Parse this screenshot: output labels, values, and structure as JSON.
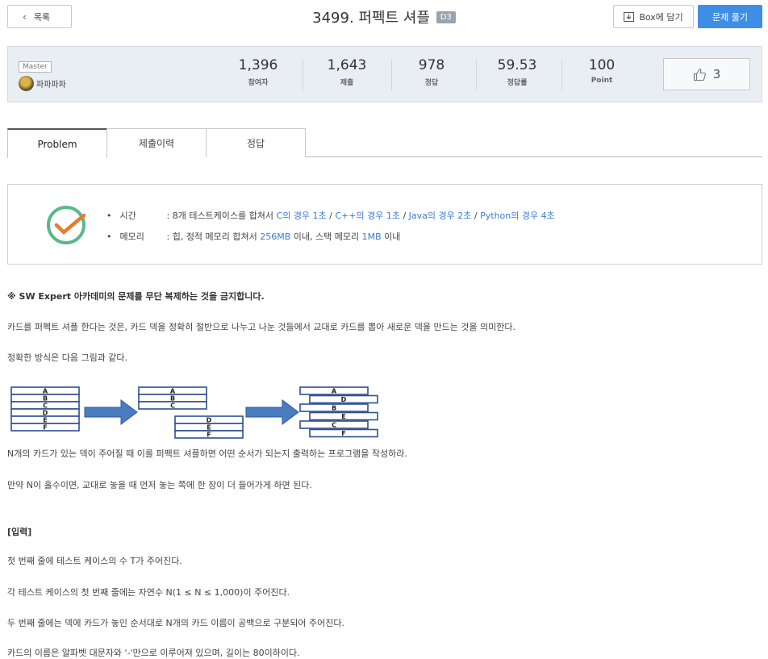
{
  "header": {
    "back_label": "목록",
    "title": "3499. 퍼펙트 셔플",
    "level": "D3",
    "box_label": "Box에 담기",
    "solve_label": "문제 풀기"
  },
  "stats": {
    "author_badge": "Master",
    "author_name": "파파파파",
    "items": [
      {
        "value": "1,396",
        "label": "참여자"
      },
      {
        "value": "1,643",
        "label": "제출"
      },
      {
        "value": "978",
        "label": "정답"
      },
      {
        "value": "59.53",
        "label": "정답률"
      },
      {
        "value": "100",
        "label": "Point"
      }
    ],
    "likes": "3"
  },
  "tabs": [
    {
      "label": "Problem"
    },
    {
      "label": "제출이력"
    },
    {
      "label": "정답"
    }
  ],
  "limits": {
    "time_key": "시간",
    "time_prefix": ": 8개 테스트케이스를 합쳐서 ",
    "time_c": "C의 경우 1초",
    "time_cpp": "C++의 경우 1초",
    "time_java": "Java의 경우 2초",
    "time_python": "Python의 경우 4초",
    "sep": " / ",
    "mem_key": "메모리",
    "mem_prefix": ": 힙, 정적 메모리 합쳐서 ",
    "mem_heap": "256MB",
    "mem_mid": " 이내, 스택 메모리 ",
    "mem_stack": "1MB",
    "mem_suffix": " 이내"
  },
  "content": {
    "notice": "※ SW Expert 아카데미의 문제를 무단 복제하는 것을 금지합니다.",
    "p1": "카드를 퍼펙트 셔플 한다는 것은, 카드 덱을 정확히 절반으로 나누고 나눈 것들에서 교대로 카드를 뽑아 새로운 덱을 만드는 것을 의미한다.",
    "p2": "정확한 방식은 다음 그림과 같다.",
    "p3": "N개의 카드가 있는 덱이 주어질 때 이를 퍼펙트 셔플하면 어떤 순서가 되는지 출력하는 프로그램을 작성하라.",
    "p4": "만약 N이 홀수이면, 교대로 놓을 때 먼저 놓는 쪽에 한 장이 더 들어가게 하면 된다.",
    "input_heading": "[입력]",
    "i1": "첫 번째 줄에 테스트 케이스의 수 T가 주어진다.",
    "i2": "각 테스트 케이스의 첫 번째 줄에는 자연수 N(1 ≤ N ≤ 1,000)이 주어진다.",
    "i3": "두 번째 줄에는 덱에 카드가 놓인 순서대로 N개의 카드 이름이 공백으로 구분되어 주어진다.",
    "i4": "카드의 이름은 알파벳 대문자와 '-'만으로 이루어져 있으며, 길이는 80이하이다."
  },
  "diagram": {
    "deck": [
      "A",
      "B",
      "C",
      "D",
      "E",
      "F"
    ],
    "top_half": [
      "A",
      "B",
      "C"
    ],
    "bottom_half": [
      "D",
      "E",
      "F"
    ],
    "shuffled": [
      "A",
      "D",
      "B",
      "E",
      "C",
      "F"
    ]
  },
  "colors": {
    "accent": "#3f8ee6",
    "link": "#3a7bd5",
    "card_border": "#2f4f8f",
    "arrow": "#4a7cc0",
    "check": "#5ab88a",
    "check_mark": "#e57c2e"
  }
}
